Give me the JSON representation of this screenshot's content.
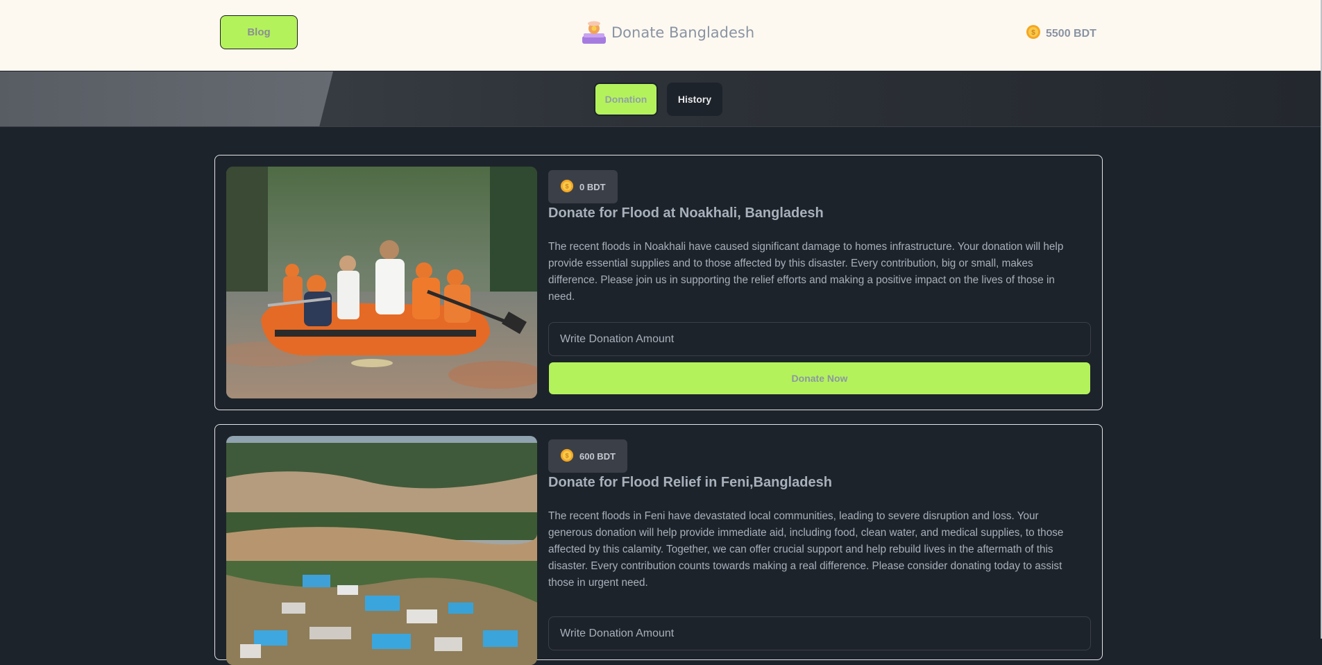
{
  "header": {
    "blog_label": "Blog",
    "brand_name": "Donate Bangladesh",
    "balance": "5500 BDT"
  },
  "tabs": {
    "donation_label": "Donation",
    "history_label": "History"
  },
  "cards": [
    {
      "amount": "0 BDT",
      "title": "Donate for Flood at Noakhali, Bangladesh",
      "description": "The recent floods in Noakhali have caused significant damage to homes infrastructure. Your donation will help provide essential supplies and to those affected by this disaster. Every contribution, big or small, makes difference. Please join us in supporting the relief efforts and making a positive impact on the lives of those in need.",
      "input_placeholder": "Write Donation Amount",
      "button_label": "Donate Now"
    },
    {
      "amount": "600 BDT",
      "title": "Donate for Flood Relief in Feni,Bangladesh",
      "description": "The recent floods in Feni have devastated local communities, leading to severe disruption and loss. Your generous donation will help provide immediate aid, including food, clean water, and medical supplies, to those affected by this calamity. Together, we can offer crucial support and help rebuild lives in the aftermath of this disaster. Every contribution counts towards making a real difference. Please consider donating today to assist those in urgent need.",
      "input_placeholder": "Write Donation Amount"
    }
  ],
  "colors": {
    "accent": "#b4f25c",
    "background": "#1d232a",
    "header_bg": "#fdf9f1"
  },
  "icons": {
    "coin": "coin-icon",
    "brand": "donation-box-logo"
  }
}
